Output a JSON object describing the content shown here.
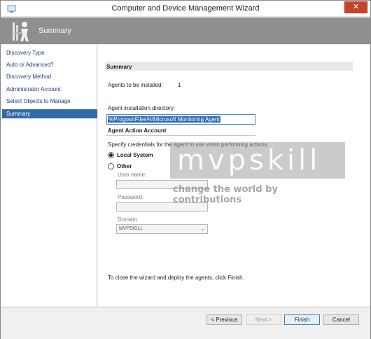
{
  "window": {
    "title": "Computer and Device Management Wizard",
    "close_glyph": "✕"
  },
  "header": {
    "title": "Summary",
    "icon": "wizard-figure-icon"
  },
  "nav": {
    "items": [
      {
        "label": "Discovery Type"
      },
      {
        "label": "Auto or Advanced?"
      },
      {
        "label": "Discovery Method"
      },
      {
        "label": "Administrator Account"
      },
      {
        "label": "Select Objects to Manage"
      },
      {
        "label": "Summary",
        "active": true
      }
    ]
  },
  "summary": {
    "section_title": "Summary",
    "agents_label": "Agents to be installed:",
    "agents_count": "1",
    "install_dir_label": "Agent installation directory:",
    "install_dir_value": "%ProgramFiles%\\Microsoft Monitoring Agent"
  },
  "action_account": {
    "section_title": "Agent Action Account",
    "description": "Specify credentials for the agent to use when performing actions.",
    "local_system_label": "Local System",
    "local_system_selected": true,
    "other_label": "Other",
    "user_name_label": "User name:",
    "user_name_value": "",
    "password_label": "Password:",
    "password_value": "",
    "domain_label": "Domain:",
    "domain_value": "MVPSKILL"
  },
  "watermark": {
    "title": "mvpskill",
    "tagline": "change the world by contributions"
  },
  "finish_note": "To close the wizard and deploy the agents, click Finish.",
  "buttons": {
    "previous": "< Previous",
    "next": "Next >",
    "finish": "Finish",
    "cancel": "Cancel"
  },
  "colors": {
    "accent": "#3469a8",
    "header_band": "#8f8f8f",
    "close": "#c7422b"
  }
}
